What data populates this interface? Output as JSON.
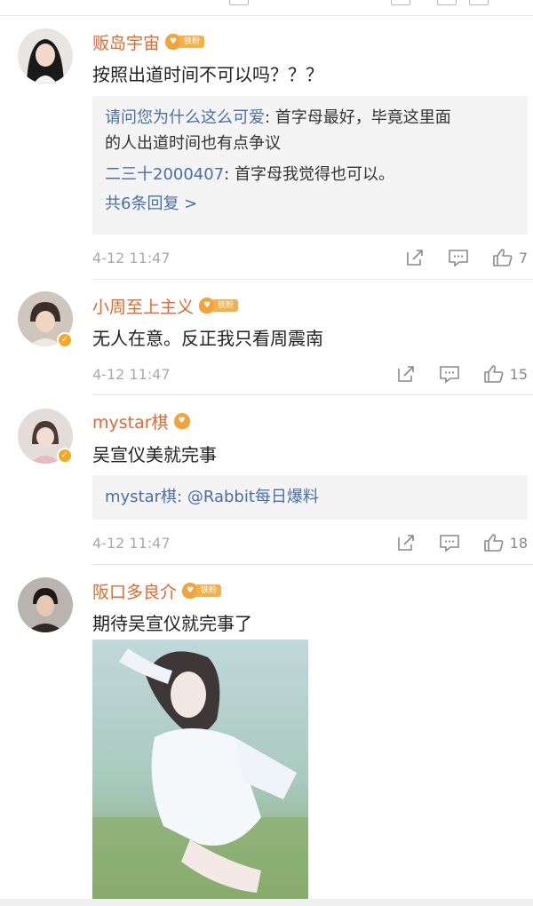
{
  "comments": [
    {
      "username": "贩岛宇宙",
      "badge": "铁粉",
      "text": "按照出道时间不可以吗？？？",
      "replies": [
        {
          "name": "请问您为什么这么可爱",
          "sep": ": ",
          "text_line1": "首字母最好，毕竟这里面",
          "text_line2": "的人出道时间也有点争议"
        },
        {
          "name": "二三十2000407",
          "sep": ": ",
          "text_line1": "首字母我觉得也可以。"
        }
      ],
      "more_replies": "共6条回复 >",
      "time": "4-12 11:47",
      "likes": "7"
    },
    {
      "username": "小周至上主义",
      "badge": "铁粉",
      "text": "无人在意。反正我只看周震南",
      "time": "4-12 11:47",
      "likes": "15"
    },
    {
      "username": "mystar棋",
      "text": "吴宣仪美就完事",
      "replies": [
        {
          "name": "mystar棋",
          "sep": ": ",
          "text_line1": "@Rabbit每日爆料"
        }
      ],
      "time": "4-12 11:47",
      "likes": "18"
    },
    {
      "username": "阪口多良介",
      "badge": "铁粉",
      "text": "期待吴宣仪就完事了"
    }
  ],
  "colors": {
    "username": "#e8662c",
    "reply_name": "#4a6fa5",
    "badge": "#f3a33a",
    "meta": "#aaaaaa"
  },
  "icons": [
    "share-icon",
    "comment-icon",
    "like-icon",
    "verified-badge-icon",
    "fan-badge-icon"
  ]
}
